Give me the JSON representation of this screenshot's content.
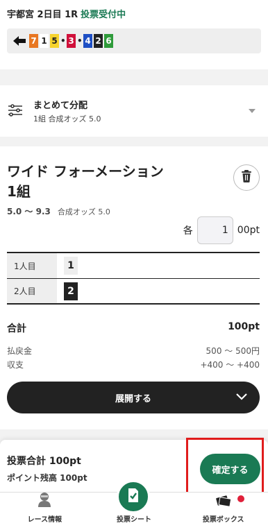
{
  "header": {
    "race": "宇都宮 2日目 1R",
    "status": "投票受付中",
    "order": [
      {
        "type": "num",
        "value": "7",
        "bg": "#e87722",
        "fg": "#ffffff"
      },
      {
        "type": "num",
        "value": "1",
        "bg": "#ffffff",
        "fg": "#222222"
      },
      {
        "type": "num",
        "value": "5",
        "bg": "#f6d32d",
        "fg": "#222222"
      },
      {
        "type": "dot",
        "value": "•"
      },
      {
        "type": "num",
        "value": "3",
        "bg": "#d0103a",
        "fg": "#ffffff"
      },
      {
        "type": "dot",
        "value": "•"
      },
      {
        "type": "num",
        "value": "4",
        "bg": "#1e4fc4",
        "fg": "#ffffff"
      },
      {
        "type": "num",
        "value": "2",
        "bg": "#222222",
        "fg": "#ffffff"
      },
      {
        "type": "num",
        "value": "6",
        "bg": "#2f9b3a",
        "fg": "#ffffff"
      }
    ]
  },
  "distribution": {
    "title": "まとめて分配",
    "sub": "1組 合成オッズ 5.0"
  },
  "bet": {
    "title_line1": "ワイド フォーメーション",
    "title_line2": "1組",
    "odds_range": "5.0 〜 9.3",
    "odds_sub": "合成オッズ 5.0",
    "each_label": "各",
    "amount": "1",
    "unit": "00pt",
    "selections": [
      {
        "label": "1人目",
        "num": "1",
        "bg": "#eeeeee",
        "fg": "#222222"
      },
      {
        "label": "2人目",
        "num": "2",
        "bg": "#222222",
        "fg": "#ffffff"
      }
    ],
    "total_label": "合計",
    "total_value": "100pt",
    "payout_label": "払戻金",
    "payout_value": "500 〜 500円",
    "balance_label": "収支",
    "balance_value": "+400 〜 +400",
    "expand_label": "展開する"
  },
  "summary": {
    "total": "投票合計 100pt",
    "points": "ポイント残高 100pt",
    "confirm_label": "確定する"
  },
  "nav": {
    "race_info": "レース情報",
    "sheet": "投票シート",
    "box": "投票ボックス"
  },
  "colors": {
    "accent": "#1a7a54",
    "highlight": "#e01c1c"
  }
}
